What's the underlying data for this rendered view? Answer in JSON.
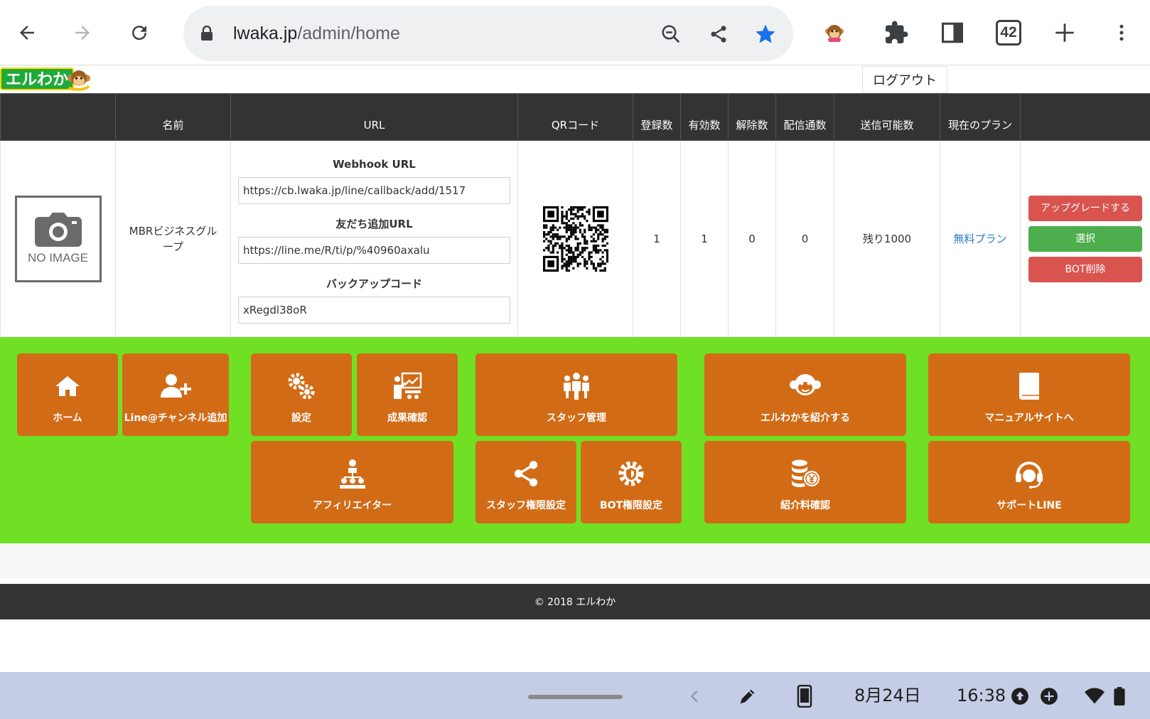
{
  "browser": {
    "url_host": "lwaka.jp",
    "url_path": "/admin/home",
    "tab_count": "42"
  },
  "header": {
    "logo_text": "エルわか",
    "logout_label": "ログアウト"
  },
  "table": {
    "headers": {
      "image": "",
      "name": "名前",
      "url": "URL",
      "qr": "QRコード",
      "registered": "登録数",
      "active": "有効数",
      "unsubscribed": "解除数",
      "delivered": "配信通数",
      "sendable": "送信可能数",
      "plan": "現在のプラン",
      "actions": ""
    },
    "row": {
      "no_image_label": "NO IMAGE",
      "name": "MBRビジネスグループ",
      "webhook_title": "Webhook URL",
      "webhook_url": "https://cb.lwaka.jp/line/callback/add/1517",
      "friend_title": "友だち追加URL",
      "friend_url": "https://line.me/R/ti/p/%40960axalu",
      "backup_title": "バックアップコード",
      "backup_code": "xRegdl38oR",
      "registered": "1",
      "active": "1",
      "unsubscribed": "0",
      "delivered": "0",
      "sendable": "残り1000",
      "plan": "無料プラン",
      "upgrade_label": "アップグレードする",
      "select_label": "選択",
      "delete_label": "BOT削除"
    }
  },
  "menu": {
    "home": "ホーム",
    "add_channel": "Line@チャンネル追加",
    "settings": "設定",
    "results": "成果確認",
    "staff": "スタッフ管理",
    "introduce": "エルわかを紹介する",
    "manual": "マニュアルサイトへ",
    "affiliate": "アフィリエイター",
    "staff_perm": "スタッフ権限設定",
    "bot_perm": "BOT権限設定",
    "referral_fee": "紹介料確認",
    "support": "サポートLINE"
  },
  "footer": {
    "copyright": "© 2018 エルわか"
  },
  "shelf": {
    "date": "8月24日",
    "time": "16:38"
  },
  "colors": {
    "menu_bg": "#6fe024",
    "tile": "#d26b16",
    "header_bg": "#333333",
    "danger": "#d9534f",
    "success": "#4cae4c",
    "link": "#2a7ac2"
  }
}
